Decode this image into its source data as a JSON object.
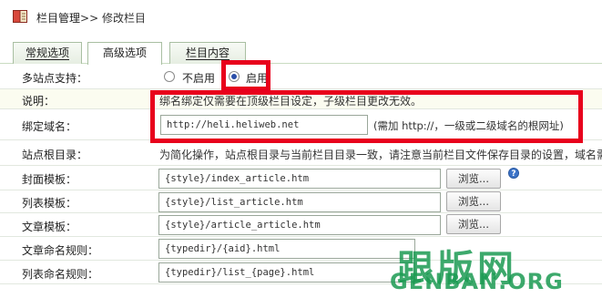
{
  "breadcrumb": {
    "section": "栏目管理",
    "separator": ">>",
    "current": "修改栏目"
  },
  "tabs": [
    {
      "label": "常规选项"
    },
    {
      "label": "高级选项"
    },
    {
      "label": "栏目内容"
    }
  ],
  "multisite": {
    "label": "多站点支持：",
    "options": [
      {
        "label": "不启用"
      },
      {
        "label": "启用"
      }
    ],
    "selected": "启用"
  },
  "description": {
    "label": "说明：",
    "text": "绑名绑定仅需要在顶级栏目设定，子级栏目更改无效。"
  },
  "bind_domain": {
    "label": "绑定域名：",
    "value": "http://heli.heliweb.net",
    "hint": "(需加 http://，一级或二级域名的根网址)"
  },
  "site_root": {
    "label": "站点根目录：",
    "text": "为简化操作，站点根目录与当前栏目目录一致，请注意当前栏目文件保存目录的设置，域名需"
  },
  "templates": {
    "browse_label": "浏览...",
    "cover": {
      "label": "封面模板：",
      "value": "{style}/index_article.htm"
    },
    "list": {
      "label": "列表模板：",
      "value": "{style}/list_article.htm"
    },
    "article": {
      "label": "文章模板：",
      "value": "{style}/article_article.htm"
    }
  },
  "naming": {
    "article": {
      "label": "文章命名规则：",
      "value": "{typedir}/{aid}.html"
    },
    "list": {
      "label": "列表命名规则：",
      "value": "{typedir}/list_{page}.html"
    }
  },
  "help_icon": "?",
  "watermark": {
    "cn": "跟版网",
    "en": "GENBAN.ORG"
  },
  "colors": {
    "highlight": "#e8001c",
    "watermark": "#1c9b53",
    "radio_selected": "#2a4ea8"
  }
}
